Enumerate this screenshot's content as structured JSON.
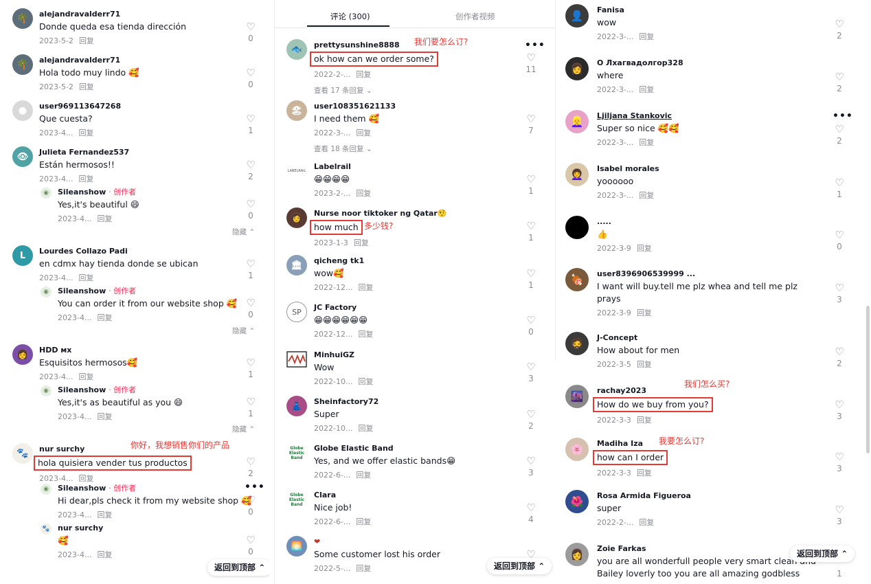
{
  "ui": {
    "reply_label": "回复",
    "hide_label": "隐藏",
    "back_to_top": "返回到顶部",
    "author_tag": "· 创作者"
  },
  "tabs": [
    {
      "label": "评论 (300)",
      "active": true
    },
    {
      "label": "创作者视频",
      "active": false
    }
  ],
  "left": {
    "c1": {
      "user": "alejandravalderr71",
      "text": "Donde queda esa tienda dirección",
      "date": "2023-5-2",
      "likes": "0"
    },
    "c2": {
      "user": "alejandravalderr71",
      "text": "Hola todo muy lindo 🥰",
      "date": "2023-5-2",
      "likes": "0"
    },
    "c3": {
      "user": "user969113647268",
      "text": "Que cuesta?",
      "date": "2023-4...",
      "likes": "1"
    },
    "c4": {
      "user": "Julieta Fernandez537",
      "text": "Están hermosos!!",
      "date": "2023-4...",
      "likes": "2"
    },
    "r4": {
      "user": "Sileanshow",
      "text": "Yes,it's beautiful 😄",
      "date": "2023-4...",
      "likes": "0"
    },
    "c5": {
      "user": "Lourdes Collazo Padi",
      "text": "en cdmx hay tienda donde se ubican",
      "date": "2023-4...",
      "likes": "1",
      "avatar_letter": "L"
    },
    "r5": {
      "user": "Sileanshow",
      "text": "You can order it from our website shop 🥰",
      "date": "2023-4...",
      "likes": "0"
    },
    "c6": {
      "user": "HDD мх",
      "text": "Esquisitos hermosos🥰",
      "date": "2023-4...",
      "likes": "1"
    },
    "r6": {
      "user": "Sileanshow",
      "text": "Yes,it's as beautiful as you 😄",
      "date": "2023-4...",
      "likes": "1"
    },
    "c7": {
      "user": "nur surchy",
      "text": "hola quisiera vender tus productos",
      "date": "2023-4...",
      "likes": "2",
      "annotation": "你好，我想销售你们的产品"
    },
    "r7a": {
      "user": "Sileanshow",
      "text": "Hi dear,pls check it from my website shop 🥰",
      "date": "2023-4...",
      "likes": "0"
    },
    "r7b": {
      "user": "nur surchy",
      "text": "🥰",
      "date": "2023-4...",
      "likes": "0"
    }
  },
  "mid": {
    "c1": {
      "user": "prettysunshine8888",
      "text": "ok how can we order some?",
      "date": "2022-2-...",
      "likes": "11",
      "view_more": "查看 17 条回复",
      "annotation": "我们要怎么订?"
    },
    "c2": {
      "user": "user108351621133",
      "text": "I need them 🥰",
      "date": "2022-3-...",
      "likes": "7",
      "view_more": "查看 18 条回复"
    },
    "c3": {
      "user": "Labelrail",
      "text": "😁😁😁😁",
      "date": "2023-2-...",
      "likes": "1",
      "avatar_text": "LABELRAIL"
    },
    "c4": {
      "user": "Nurse noor tiktoker ng Qatar🤨",
      "text": "how much",
      "date": "2023-1-3",
      "likes": "1",
      "annotation": "多少钱?"
    },
    "c5": {
      "user": "qicheng tk1",
      "text": "wow🥰",
      "date": "2022-12...",
      "likes": "1"
    },
    "c6": {
      "user": "JC Factory",
      "text": "😁😁😁😁😁😁",
      "date": "2022-12...",
      "likes": "0",
      "avatar_text": "SP"
    },
    "c7": {
      "user": "MinhuiGZ",
      "text": "Wow",
      "date": "2022-10...",
      "likes": "3"
    },
    "c8": {
      "user": "Sheinfactory72",
      "text": "Super",
      "date": "2022-10...",
      "likes": "2"
    },
    "c9": {
      "user": "Globe Elastic Band",
      "text": "Yes, and we offer elastic bands😁",
      "date": "2022-6-...",
      "likes": "3",
      "avatar_text": "Globe Elastic Band"
    },
    "c10": {
      "user": "Clara",
      "text": "Nice job!",
      "date": "2022-6-...",
      "likes": "4",
      "avatar_text": "Globe Elastic Band"
    },
    "c11": {
      "user": "❤",
      "text": "Some customer lost his order",
      "date": "2022-5-...",
      "likes": "0"
    }
  },
  "right": {
    "c1": {
      "user": "Fanisa",
      "text": "wow",
      "date": "2022-3-...",
      "likes": "2"
    },
    "c2": {
      "user": "О Лхагвадолгор328",
      "text": "where",
      "date": "2022-3-...",
      "likes": "2"
    },
    "c3": {
      "user": "Ljiljana Stankovic",
      "text": "Super so nice 🥰🥰",
      "date": "2022-3-...",
      "likes": "2"
    },
    "c4": {
      "user": "Isabel morales",
      "text": "yoooooo",
      "date": "2022-3-...",
      "likes": "1"
    },
    "c5": {
      "user": ".....",
      "text": "👍",
      "date": "2022-3-9",
      "likes": "0"
    },
    "c6": {
      "user": "user8396906539999 ...",
      "text": "I want will buy.tell me plz whea and tell me plz prays",
      "date": "2022-3-9",
      "likes": "3"
    },
    "c7": {
      "user": "J-Concept",
      "text": "How about for men",
      "date": "2022-3-5",
      "likes": "2"
    },
    "c8": {
      "user": "rachay2023",
      "text": "How do we buy from you?",
      "date": "2022-3-3",
      "likes": "3",
      "annotation": "我们怎么买?"
    },
    "c9": {
      "user": "Madiha Iza",
      "text": "how can I order",
      "date": "2022-3-3",
      "likes": "3",
      "annotation": "我要怎么订?"
    },
    "c10": {
      "user": "Rosa Armida Figueroa",
      "text": "super",
      "date": "2022-2-...",
      "likes": "3"
    },
    "c11": {
      "user": "Zoie Farkas",
      "text": "you are all wonderfull people very smart clean and Bailey loverly too you are all amazing godbless",
      "date": "",
      "likes": "1"
    }
  },
  "colors": {
    "accent": "#fe2c55",
    "highlight": "#e53935",
    "muted": "#8a8b91"
  }
}
